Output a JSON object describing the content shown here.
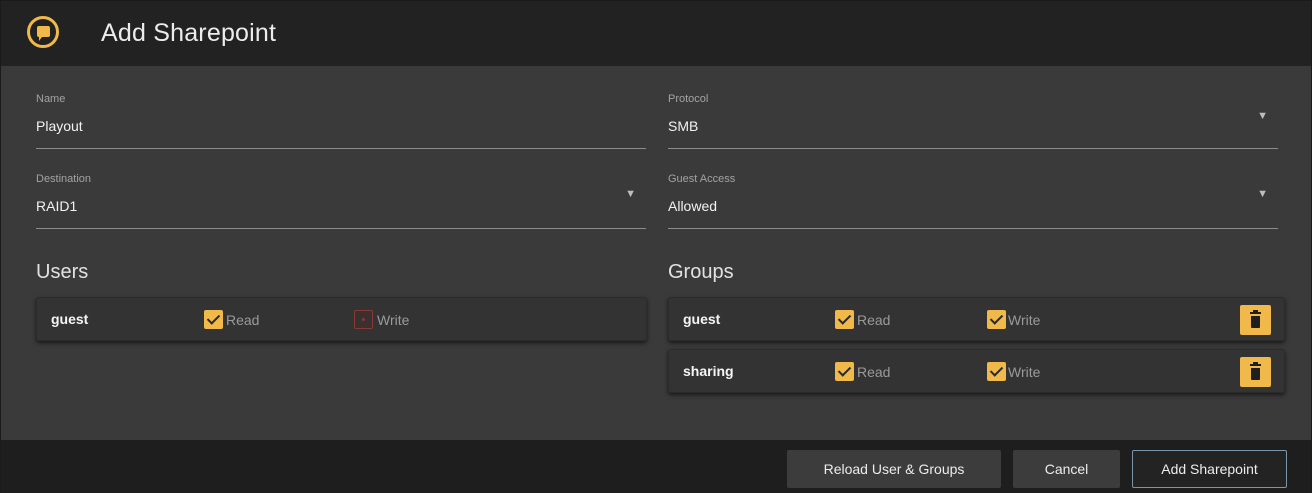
{
  "dialog": {
    "title": "Add Sharepoint"
  },
  "fields": {
    "name": {
      "label": "Name",
      "value": "Playout"
    },
    "protocol": {
      "label": "Protocol",
      "value": "SMB"
    },
    "destination": {
      "label": "Destination",
      "value": "RAID1"
    },
    "guest_access": {
      "label": "Guest Access",
      "value": "Allowed"
    }
  },
  "users": {
    "title": "Users",
    "rows": [
      {
        "name": "guest",
        "read_label": "Read",
        "read": true,
        "write_label": "Write",
        "write": false
      }
    ]
  },
  "groups": {
    "title": "Groups",
    "rows": [
      {
        "name": "guest",
        "read_label": "Read",
        "read": true,
        "write_label": "Write",
        "write": true
      },
      {
        "name": "sharing",
        "read_label": "Read",
        "read": true,
        "write_label": "Write",
        "write": true
      }
    ]
  },
  "footer": {
    "reload_label": "Reload User & Groups",
    "cancel_label": "Cancel",
    "add_label": "Add Sharepoint"
  },
  "colors": {
    "accent": "#f0b94a",
    "background": "#3a3a3a",
    "titlebar": "#222222",
    "footer": "#1e1e1e"
  },
  "icons": {
    "app": "chat-bubble-icon",
    "dropdown": "caret-down-icon",
    "delete": "trash-icon"
  }
}
